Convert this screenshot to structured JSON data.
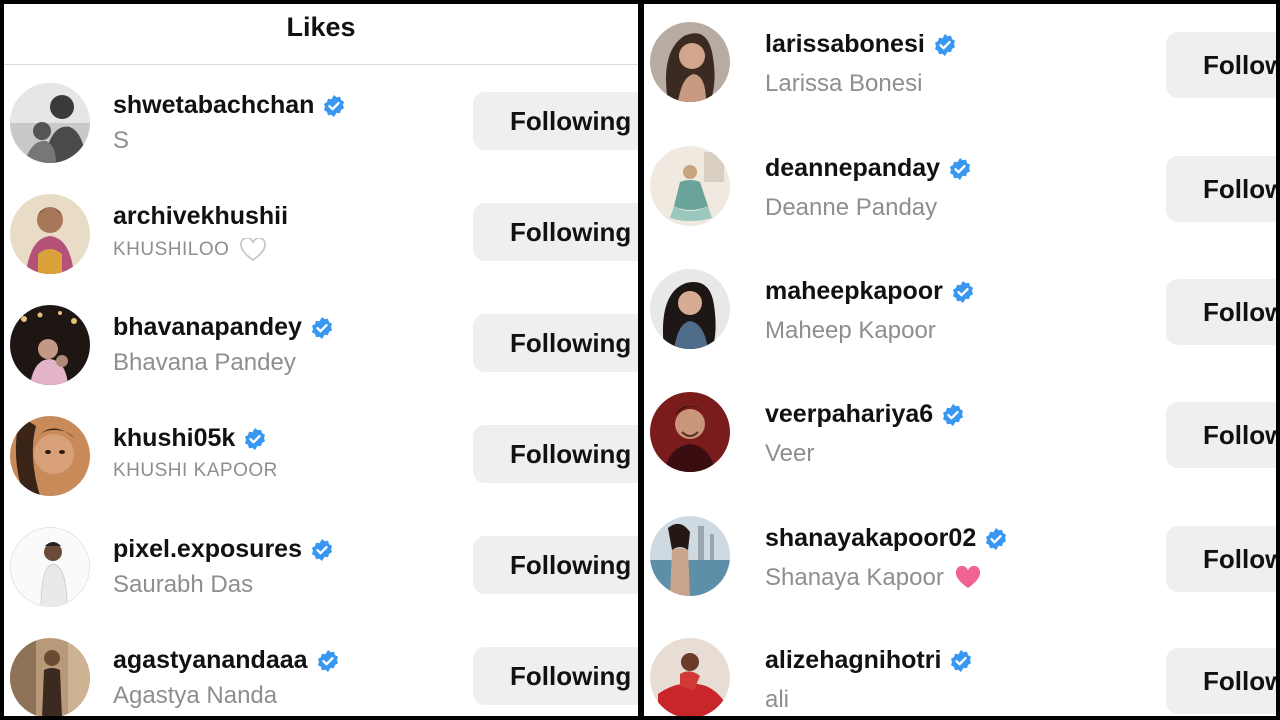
{
  "left": {
    "title": "Likes",
    "rows": [
      {
        "username": "shwetabachchan",
        "name": "S",
        "button": "Following"
      },
      {
        "username": "archivekhushii",
        "name": "KHUSHILOO",
        "button": "Following"
      },
      {
        "username": "bhavanapandey",
        "name": "Bhavana Pandey",
        "button": "Following"
      },
      {
        "username": "khushi05k",
        "name": "KHUSHI KAPOOR",
        "button": "Following"
      },
      {
        "username": "pixel.exposures",
        "name": "Saurabh Das",
        "button": "Following"
      },
      {
        "username": "agastyanandaaa",
        "name": "Agastya Nanda",
        "button": "Following"
      }
    ]
  },
  "right": {
    "rows": [
      {
        "username": "larissabonesi",
        "name": "Larissa Bonesi",
        "button": "Follow"
      },
      {
        "username": "deannepanday",
        "name": "Deanne Panday",
        "button": "Follow"
      },
      {
        "username": "maheepkapoor",
        "name": "Maheep Kapoor",
        "button": "Follow"
      },
      {
        "username": "veerpahariya6",
        "name": "Veer",
        "button": "Follow"
      },
      {
        "username": "shanayakapoor02",
        "name": "Shanaya Kapoor",
        "button": "Follow"
      },
      {
        "username": "alizehagnihotri",
        "name": "ali",
        "button": "Follow"
      }
    ]
  },
  "colors": {
    "verified": "#3897f0",
    "button_bg": "#efefef",
    "muted_text": "#8e8e8e",
    "pink_heart": "#f06292"
  },
  "icons": {
    "verified": "verified-badge-icon",
    "white_heart": "white-heart-icon",
    "pink_heart": "pink-heart-icon"
  }
}
